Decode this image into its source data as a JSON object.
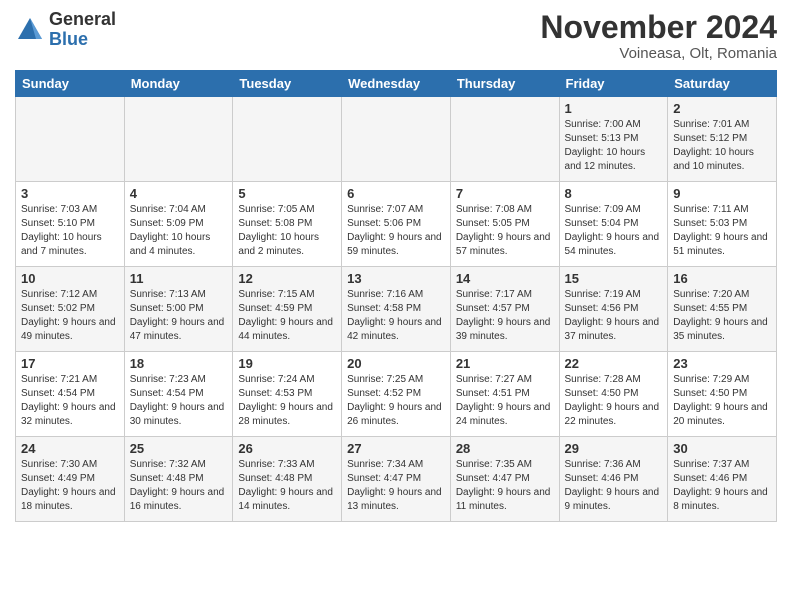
{
  "header": {
    "logo_general": "General",
    "logo_blue": "Blue",
    "month_title": "November 2024",
    "location": "Voineasa, Olt, Romania"
  },
  "days_of_week": [
    "Sunday",
    "Monday",
    "Tuesday",
    "Wednesday",
    "Thursday",
    "Friday",
    "Saturday"
  ],
  "weeks": [
    [
      {
        "day": "",
        "info": ""
      },
      {
        "day": "",
        "info": ""
      },
      {
        "day": "",
        "info": ""
      },
      {
        "day": "",
        "info": ""
      },
      {
        "day": "",
        "info": ""
      },
      {
        "day": "1",
        "info": "Sunrise: 7:00 AM\nSunset: 5:13 PM\nDaylight: 10 hours and 12 minutes."
      },
      {
        "day": "2",
        "info": "Sunrise: 7:01 AM\nSunset: 5:12 PM\nDaylight: 10 hours and 10 minutes."
      }
    ],
    [
      {
        "day": "3",
        "info": "Sunrise: 7:03 AM\nSunset: 5:10 PM\nDaylight: 10 hours and 7 minutes."
      },
      {
        "day": "4",
        "info": "Sunrise: 7:04 AM\nSunset: 5:09 PM\nDaylight: 10 hours and 4 minutes."
      },
      {
        "day": "5",
        "info": "Sunrise: 7:05 AM\nSunset: 5:08 PM\nDaylight: 10 hours and 2 minutes."
      },
      {
        "day": "6",
        "info": "Sunrise: 7:07 AM\nSunset: 5:06 PM\nDaylight: 9 hours and 59 minutes."
      },
      {
        "day": "7",
        "info": "Sunrise: 7:08 AM\nSunset: 5:05 PM\nDaylight: 9 hours and 57 minutes."
      },
      {
        "day": "8",
        "info": "Sunrise: 7:09 AM\nSunset: 5:04 PM\nDaylight: 9 hours and 54 minutes."
      },
      {
        "day": "9",
        "info": "Sunrise: 7:11 AM\nSunset: 5:03 PM\nDaylight: 9 hours and 51 minutes."
      }
    ],
    [
      {
        "day": "10",
        "info": "Sunrise: 7:12 AM\nSunset: 5:02 PM\nDaylight: 9 hours and 49 minutes."
      },
      {
        "day": "11",
        "info": "Sunrise: 7:13 AM\nSunset: 5:00 PM\nDaylight: 9 hours and 47 minutes."
      },
      {
        "day": "12",
        "info": "Sunrise: 7:15 AM\nSunset: 4:59 PM\nDaylight: 9 hours and 44 minutes."
      },
      {
        "day": "13",
        "info": "Sunrise: 7:16 AM\nSunset: 4:58 PM\nDaylight: 9 hours and 42 minutes."
      },
      {
        "day": "14",
        "info": "Sunrise: 7:17 AM\nSunset: 4:57 PM\nDaylight: 9 hours and 39 minutes."
      },
      {
        "day": "15",
        "info": "Sunrise: 7:19 AM\nSunset: 4:56 PM\nDaylight: 9 hours and 37 minutes."
      },
      {
        "day": "16",
        "info": "Sunrise: 7:20 AM\nSunset: 4:55 PM\nDaylight: 9 hours and 35 minutes."
      }
    ],
    [
      {
        "day": "17",
        "info": "Sunrise: 7:21 AM\nSunset: 4:54 PM\nDaylight: 9 hours and 32 minutes."
      },
      {
        "day": "18",
        "info": "Sunrise: 7:23 AM\nSunset: 4:54 PM\nDaylight: 9 hours and 30 minutes."
      },
      {
        "day": "19",
        "info": "Sunrise: 7:24 AM\nSunset: 4:53 PM\nDaylight: 9 hours and 28 minutes."
      },
      {
        "day": "20",
        "info": "Sunrise: 7:25 AM\nSunset: 4:52 PM\nDaylight: 9 hours and 26 minutes."
      },
      {
        "day": "21",
        "info": "Sunrise: 7:27 AM\nSunset: 4:51 PM\nDaylight: 9 hours and 24 minutes."
      },
      {
        "day": "22",
        "info": "Sunrise: 7:28 AM\nSunset: 4:50 PM\nDaylight: 9 hours and 22 minutes."
      },
      {
        "day": "23",
        "info": "Sunrise: 7:29 AM\nSunset: 4:50 PM\nDaylight: 9 hours and 20 minutes."
      }
    ],
    [
      {
        "day": "24",
        "info": "Sunrise: 7:30 AM\nSunset: 4:49 PM\nDaylight: 9 hours and 18 minutes."
      },
      {
        "day": "25",
        "info": "Sunrise: 7:32 AM\nSunset: 4:48 PM\nDaylight: 9 hours and 16 minutes."
      },
      {
        "day": "26",
        "info": "Sunrise: 7:33 AM\nSunset: 4:48 PM\nDaylight: 9 hours and 14 minutes."
      },
      {
        "day": "27",
        "info": "Sunrise: 7:34 AM\nSunset: 4:47 PM\nDaylight: 9 hours and 13 minutes."
      },
      {
        "day": "28",
        "info": "Sunrise: 7:35 AM\nSunset: 4:47 PM\nDaylight: 9 hours and 11 minutes."
      },
      {
        "day": "29",
        "info": "Sunrise: 7:36 AM\nSunset: 4:46 PM\nDaylight: 9 hours and 9 minutes."
      },
      {
        "day": "30",
        "info": "Sunrise: 7:37 AM\nSunset: 4:46 PM\nDaylight: 9 hours and 8 minutes."
      }
    ]
  ]
}
